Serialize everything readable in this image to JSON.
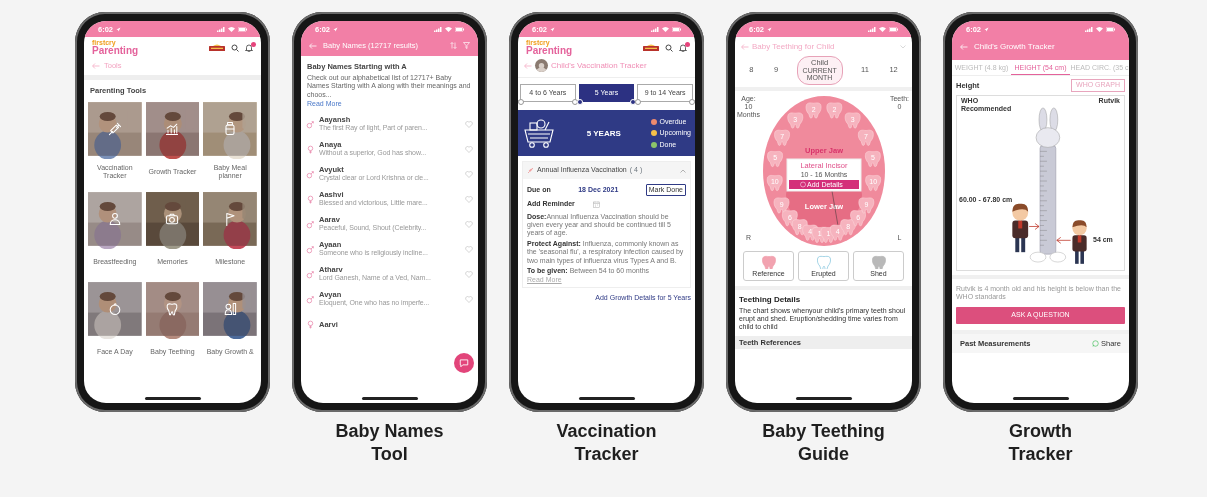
{
  "phones": [
    {
      "kind": "tools",
      "status_time": "6:02",
      "logo_tagline": "firstcry",
      "logo_name": "Parenting",
      "back_label": "Tools",
      "section_title": "Parenting Tools",
      "tiles": [
        {
          "label": "Vaccination Tracker"
        },
        {
          "label": "Growth Tracker"
        },
        {
          "label": "Baby Meal planner"
        },
        {
          "label": "Breastfeeding"
        },
        {
          "label": "Memories"
        },
        {
          "label": "Milestone"
        },
        {
          "label": "Face A Day"
        },
        {
          "label": "Baby Teething"
        },
        {
          "label": "Baby Growth &"
        }
      ]
    },
    {
      "kind": "names",
      "caption": "Baby Names Tool",
      "status_time": "6:02",
      "header_title": "Baby Names (12717 results)",
      "title": "Baby Names Starting with A",
      "description": "Check out our alphabetical list of 12717+ Baby Names Starting with A along with their meanings and choos...",
      "read_more": "Read More",
      "names": [
        {
          "name": "Aayansh",
          "meaning": "The first Ray of light, Part of paren...",
          "kind": "male"
        },
        {
          "name": "Anaya",
          "meaning": "Without a superior, God has show...",
          "kind": "female"
        },
        {
          "name": "Avyukt",
          "meaning": "Crystal clear or Lord Krishna or cle...",
          "kind": "male"
        },
        {
          "name": "Aashvi",
          "meaning": "Blessed and victorious, Little mare...",
          "kind": "female"
        },
        {
          "name": "Aarav",
          "meaning": "Peaceful, Sound, Shout (Celebrity...",
          "kind": "male"
        },
        {
          "name": "Ayaan",
          "meaning": "Someone who is religiously incline...",
          "kind": "male"
        },
        {
          "name": "Atharv",
          "meaning": "Lord Ganesh, Name of a Ved, Nam...",
          "kind": "male"
        },
        {
          "name": "Avyan",
          "meaning": "Eloquent, One who has no imperfe...",
          "kind": "male"
        },
        {
          "name": "Aarvi",
          "kind": "female"
        }
      ]
    },
    {
      "kind": "vaccination",
      "caption": "Vaccination Tracker",
      "status_time": "6:02",
      "logo_tagline": "firstcry",
      "logo_name": "Parenting",
      "title": "Child's Vaccination Tracker",
      "tabs": [
        {
          "label": "4 to 6 Years",
          "selected": false
        },
        {
          "label": "5 Years",
          "selected": true
        },
        {
          "label": "9 to 14 Years",
          "selected": false
        }
      ],
      "banner_title": "5 YEARS",
      "legend": [
        {
          "label": "Overdue",
          "color": "#ee8a6e"
        },
        {
          "label": "Upcoming",
          "color": "#f5c04a"
        },
        {
          "label": "Done",
          "color": "#8cc46a"
        }
      ],
      "vaccine": {
        "name": "Annual Influenza Vaccination",
        "count": "( 4 )",
        "expanded": true,
        "due_label": "Due on",
        "due_date": "18 Dec 2021",
        "action": "Mark Done",
        "reminder_label": "Add Reminder",
        "details": [
          "**Dose:**Annual Influenza Vaccination should be given every year and should be continued till 5 years of age.",
          "**Protect Against:** Influenza, commonly known as the 'seasonal flu', a respiratory infection caused by two main types of influenza virus Types A and B.",
          "**To be given:** Between 54 to 60 months"
        ],
        "read_more": "Read More"
      },
      "footer_link": "Add Growth Details for 5 Years"
    },
    {
      "kind": "teething",
      "caption": "Baby Teething Guide",
      "status_time": "6:02",
      "header_title": "Baby Teething for Child",
      "months": [
        {
          "label": "8",
          "selected": false
        },
        {
          "label": "9",
          "selected": false
        },
        {
          "label": "Child",
          "sublabel": "CURRENT MONTH",
          "selected": true
        },
        {
          "label": "11",
          "selected": false
        },
        {
          "label": "12",
          "selected": false
        }
      ],
      "age_label": "Age:",
      "age_value": "10 Months",
      "teeth_label": "Teeth:",
      "teeth_value": "0",
      "upper_jaw_label": "Upper Jaw",
      "lower_jaw_label": "Lower Jaw",
      "upper_teeth": [
        "10",
        "5",
        "7",
        "3",
        "2",
        "2",
        "3",
        "7",
        "5",
        "10"
      ],
      "lower_teeth": [
        "9",
        "6",
        "8",
        "4",
        "1",
        "1",
        "4",
        "8",
        "6",
        "9"
      ],
      "popup": {
        "tooth": "Lateral Incisor",
        "range": "10 - 16 Months",
        "action": "Add Details"
      },
      "side_labels": [
        "R",
        "L"
      ],
      "legend": [
        {
          "label": "Reference",
          "kind": "reference"
        },
        {
          "label": "Erupted",
          "kind": "erupted"
        },
        {
          "label": "Shed",
          "kind": "shed"
        }
      ],
      "details_title": "Teething Details",
      "details_text": "The chart shows whenyour child's primary teeth shoul erupt and shed. Eruption/shedding time varies from child to child",
      "references_title": "Teeth References"
    },
    {
      "kind": "growth",
      "caption": "Growth Tracker",
      "status_time": "6:02",
      "header_title": "Child's Growth Tracker",
      "tabs": [
        {
          "label": "WEIGHT (4.8 kg)",
          "selected": false
        },
        {
          "label": "HEIGHT (54 cm)",
          "selected": true
        },
        {
          "label": "HEAD CIRC. (35 c",
          "selected": false
        }
      ],
      "section_title": "Height",
      "graph_button": "WHO GRAPH",
      "who_label": "WHO Recommended",
      "child_name": "Rutvik",
      "who_range": "60.00 - 67.80 cm",
      "child_height": "54 cm",
      "summary": "Rutvik is 4 month old and his height is below than the WHO standards",
      "ask_button": "ASK A QUESTION",
      "past_title": "Past Measurements",
      "share_label": "Share"
    }
  ]
}
